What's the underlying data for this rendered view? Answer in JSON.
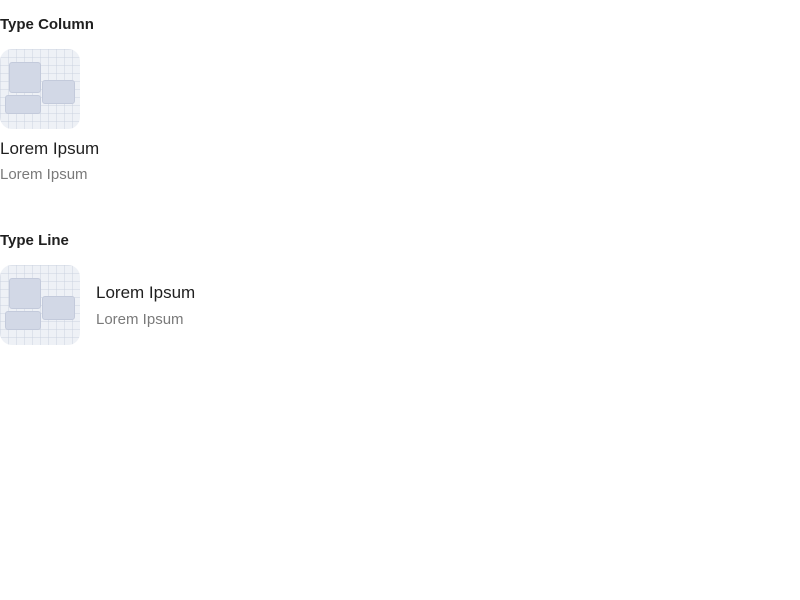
{
  "sections": [
    {
      "heading": "Type Column",
      "item": {
        "image_icon": "placeholder-image-icon",
        "title": "Lorem Ipsum",
        "subtitle": "Lorem Ipsum"
      }
    },
    {
      "heading": "Type Line",
      "item": {
        "image_icon": "placeholder-image-icon",
        "title": "Lorem Ipsum",
        "subtitle": "Lorem Ipsum"
      }
    }
  ],
  "colors": {
    "heading": "#1f1f1f",
    "title": "#1f1f1f",
    "subtitle": "#7a7a7a",
    "thumbnail_bg": "#eef1f6",
    "thumbnail_block": "#d2d8e6"
  }
}
